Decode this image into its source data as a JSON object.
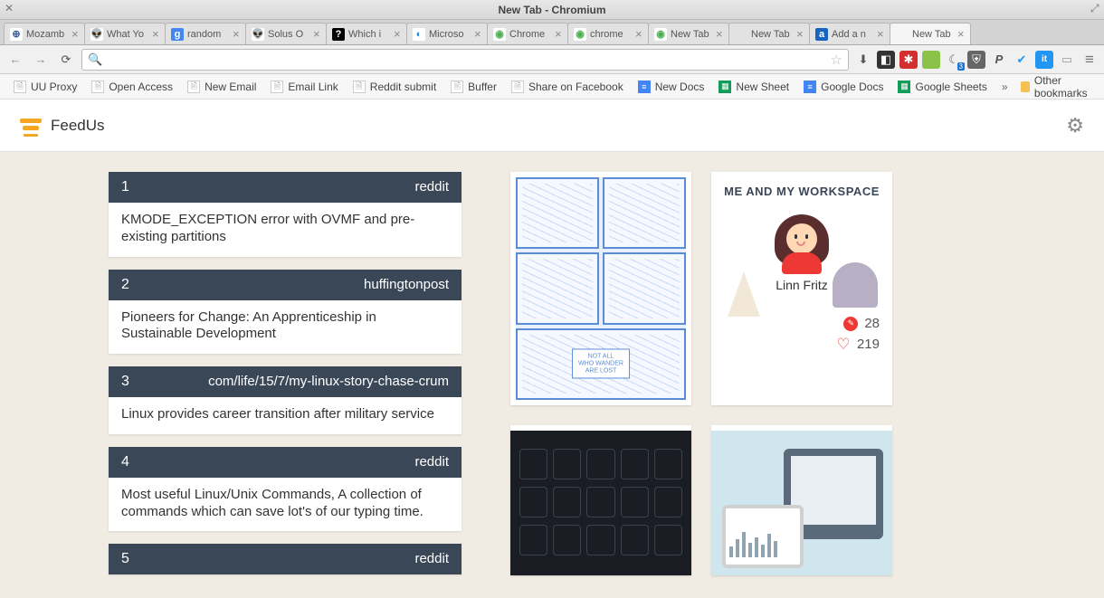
{
  "window": {
    "title": "New Tab - Chromium"
  },
  "tabs": [
    {
      "label": "Mozamb",
      "fav": "⊕",
      "favbg": "#fff",
      "favcolor": "#3b5998"
    },
    {
      "label": "What Yo",
      "fav": "👽",
      "favbg": "#fff",
      "favcolor": "#ff4500"
    },
    {
      "label": "random",
      "fav": "g",
      "favbg": "#4285f4",
      "favcolor": "#fff"
    },
    {
      "label": "Solus O",
      "fav": "👽",
      "favbg": "#fff",
      "favcolor": "#ff4500"
    },
    {
      "label": "Which i",
      "fav": "?",
      "favbg": "#000",
      "favcolor": "#fff"
    },
    {
      "label": "Microso",
      "fav": "◐",
      "favbg": "#fff",
      "favcolor": "#1e88e5"
    },
    {
      "label": "Chrome",
      "fav": "◉",
      "favbg": "#fff",
      "favcolor": "#4caf50"
    },
    {
      "label": "chrome",
      "fav": "◉",
      "favbg": "#fff",
      "favcolor": "#4caf50"
    },
    {
      "label": "New Tab",
      "fav": "◉",
      "favbg": "#fff",
      "favcolor": "#4caf50"
    },
    {
      "label": "New Tab",
      "fav": "",
      "favbg": "transparent",
      "favcolor": "#888"
    },
    {
      "label": "Add a n",
      "fav": "a",
      "favbg": "#1565c0",
      "favcolor": "#fff"
    },
    {
      "label": "New Tab",
      "fav": "",
      "favbg": "transparent",
      "favcolor": "#888",
      "active": true
    }
  ],
  "omnibox": {
    "value": "",
    "placeholder": ""
  },
  "ext": {
    "download": "⬇",
    "evernote": "◧",
    "lastpass": "✱",
    "green": "●",
    "moon": "☾",
    "moon_badge": "3",
    "ublock": "⛨",
    "paypal": "P",
    "vivaldi": "✔",
    "it": "it",
    "chat": "▭",
    "menu": "≡"
  },
  "bookmarks": [
    {
      "label": "UU Proxy",
      "type": "page"
    },
    {
      "label": "Open Access",
      "type": "page"
    },
    {
      "label": "New Email",
      "type": "page"
    },
    {
      "label": "Email Link",
      "type": "page"
    },
    {
      "label": "Reddit submit",
      "type": "page"
    },
    {
      "label": "Buffer",
      "type": "page"
    },
    {
      "label": "Share on Facebook",
      "type": "page"
    },
    {
      "label": "New Docs",
      "type": "docs"
    },
    {
      "label": "New Sheet",
      "type": "sheets"
    },
    {
      "label": "Google Docs",
      "type": "docs"
    },
    {
      "label": "Google Sheets",
      "type": "sheets"
    }
  ],
  "bookbar": {
    "overflow": "»",
    "other": "Other bookmarks"
  },
  "app": {
    "name": "FeedUs"
  },
  "feed": [
    {
      "n": "1",
      "source": "reddit",
      "title": "KMODE_EXCEPTION error with OVMF and pre-existing partitions"
    },
    {
      "n": "2",
      "source": "huffingtonpost",
      "title": "Pioneers for Change: An Apprenticeship in Sustainable Development"
    },
    {
      "n": "3",
      "source": "com/life/15/7/my-linux-story-chase-crum",
      "title": "Linux provides career transition after military service"
    },
    {
      "n": "4",
      "source": "reddit",
      "title": "Most useful Linux/Unix Commands, A collection of commands which can save lot's of our typing time."
    },
    {
      "n": "5",
      "source": "reddit",
      "title": ""
    }
  ],
  "comic_note": "NOT ALL\nWHO WANDER\nARE LOST",
  "workspace": {
    "heading": "ME AND MY WORKSPACE",
    "name": "Linn Fritz",
    "comments": "28",
    "likes": "219"
  }
}
